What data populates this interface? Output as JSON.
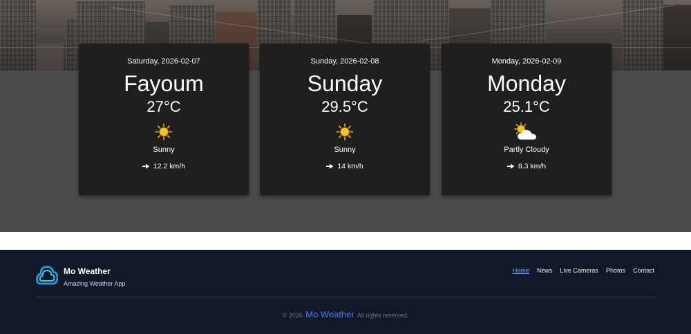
{
  "cards": [
    {
      "date": "Saturday, 2026-02-07",
      "title": "Fayoum",
      "temp": "27°C",
      "icon": "sun-icon",
      "condition": "Sunny",
      "wind": "12.2 km/h"
    },
    {
      "date": "Sunday, 2026-02-08",
      "title": "Sunday",
      "temp": "29.5°C",
      "icon": "sun-icon",
      "condition": "Sunny",
      "wind": "14 km/h"
    },
    {
      "date": "Monday, 2026-02-09",
      "title": "Monday",
      "temp": "25.1°C",
      "icon": "partly-cloudy-icon",
      "condition": "Partly Cloudy",
      "wind": "8.3 km/h"
    }
  ],
  "footer": {
    "brand_name": "Mo Weather",
    "tagline": "Amazing Weather App",
    "nav": [
      {
        "label": "Home",
        "active": true
      },
      {
        "label": "News",
        "active": false
      },
      {
        "label": "Live Cameras",
        "active": false
      },
      {
        "label": "Photos",
        "active": false
      },
      {
        "label": "Contact",
        "active": false
      }
    ],
    "copyright_prefix": "© 2026",
    "copyright_brand": "Mo Weather",
    "copyright_suffix": "All rights reserved."
  },
  "colors": {
    "accent": "#3b82f6",
    "footer_bg": "#111827",
    "card_bg": "#1f1f1f",
    "sun": "#f5b50a"
  }
}
